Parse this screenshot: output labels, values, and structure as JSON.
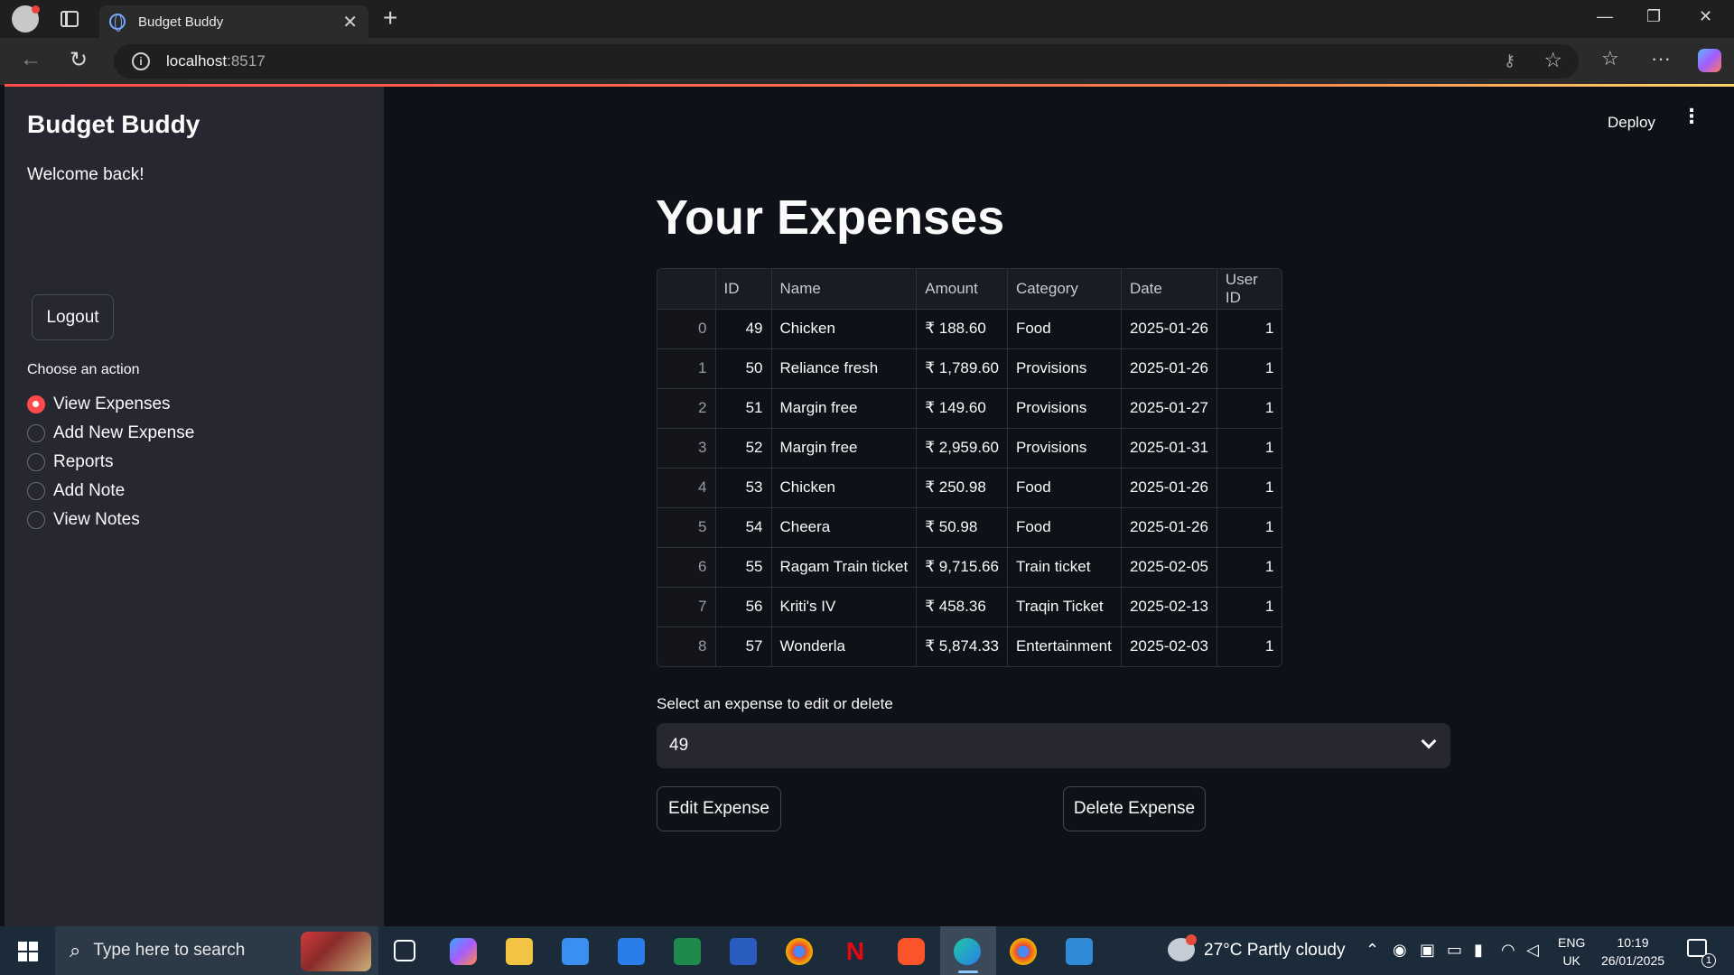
{
  "browser": {
    "tab_title": "Budget Buddy",
    "url_host": "localhost",
    "url_port": ":8517"
  },
  "header": {
    "deploy_label": "Deploy"
  },
  "sidebar": {
    "title": "Budget Buddy",
    "welcome": "Welcome back!",
    "logout_label": "Logout",
    "action_label": "Choose an action",
    "actions": [
      {
        "label": "View Expenses",
        "selected": true
      },
      {
        "label": "Add New Expense",
        "selected": false
      },
      {
        "label": "Reports",
        "selected": false
      },
      {
        "label": "Add Note",
        "selected": false
      },
      {
        "label": "View Notes",
        "selected": false
      }
    ]
  },
  "main": {
    "title": "Your Expenses",
    "table": {
      "columns": [
        "",
        "ID",
        "Name",
        "Amount",
        "Category",
        "Date",
        "User ID"
      ],
      "rows": [
        [
          "0",
          "49",
          "Chicken",
          "₹ 188.60",
          "Food",
          "2025-01-26",
          "1"
        ],
        [
          "1",
          "50",
          "Reliance fresh",
          "₹ 1,789.60",
          "Provisions",
          "2025-01-26",
          "1"
        ],
        [
          "2",
          "51",
          "Margin free",
          "₹ 149.60",
          "Provisions",
          "2025-01-27",
          "1"
        ],
        [
          "3",
          "52",
          "Margin free",
          "₹ 2,959.60",
          "Provisions",
          "2025-01-31",
          "1"
        ],
        [
          "4",
          "53",
          "Chicken",
          "₹ 250.98",
          "Food",
          "2025-01-26",
          "1"
        ],
        [
          "5",
          "54",
          "Cheera",
          "₹ 50.98",
          "Food",
          "2025-01-26",
          "1"
        ],
        [
          "6",
          "55",
          "Ragam Train ticket",
          "₹ 9,715.66",
          "Train ticket",
          "2025-02-05",
          "1"
        ],
        [
          "7",
          "56",
          "Kriti's IV",
          "₹ 458.36",
          "Traqin Ticket",
          "2025-02-13",
          "1"
        ],
        [
          "8",
          "57",
          "Wonderla",
          "₹ 5,874.33",
          "Entertainment",
          "2025-02-03",
          "1"
        ]
      ]
    },
    "select_label": "Select an expense to edit or delete",
    "select_value": "49",
    "edit_label": "Edit Expense",
    "delete_label": "Delete Expense"
  },
  "taskbar": {
    "search_placeholder": "Type here to search",
    "weather": "27°C  Partly cloudy",
    "lang_top": "ENG",
    "lang_bottom": "UK",
    "time": "10:19",
    "date": "26/01/2025",
    "notification_count": "1"
  },
  "colors": {
    "accent": "#ff4b4b",
    "background": "#0e1117",
    "sidebar": "#262730"
  }
}
